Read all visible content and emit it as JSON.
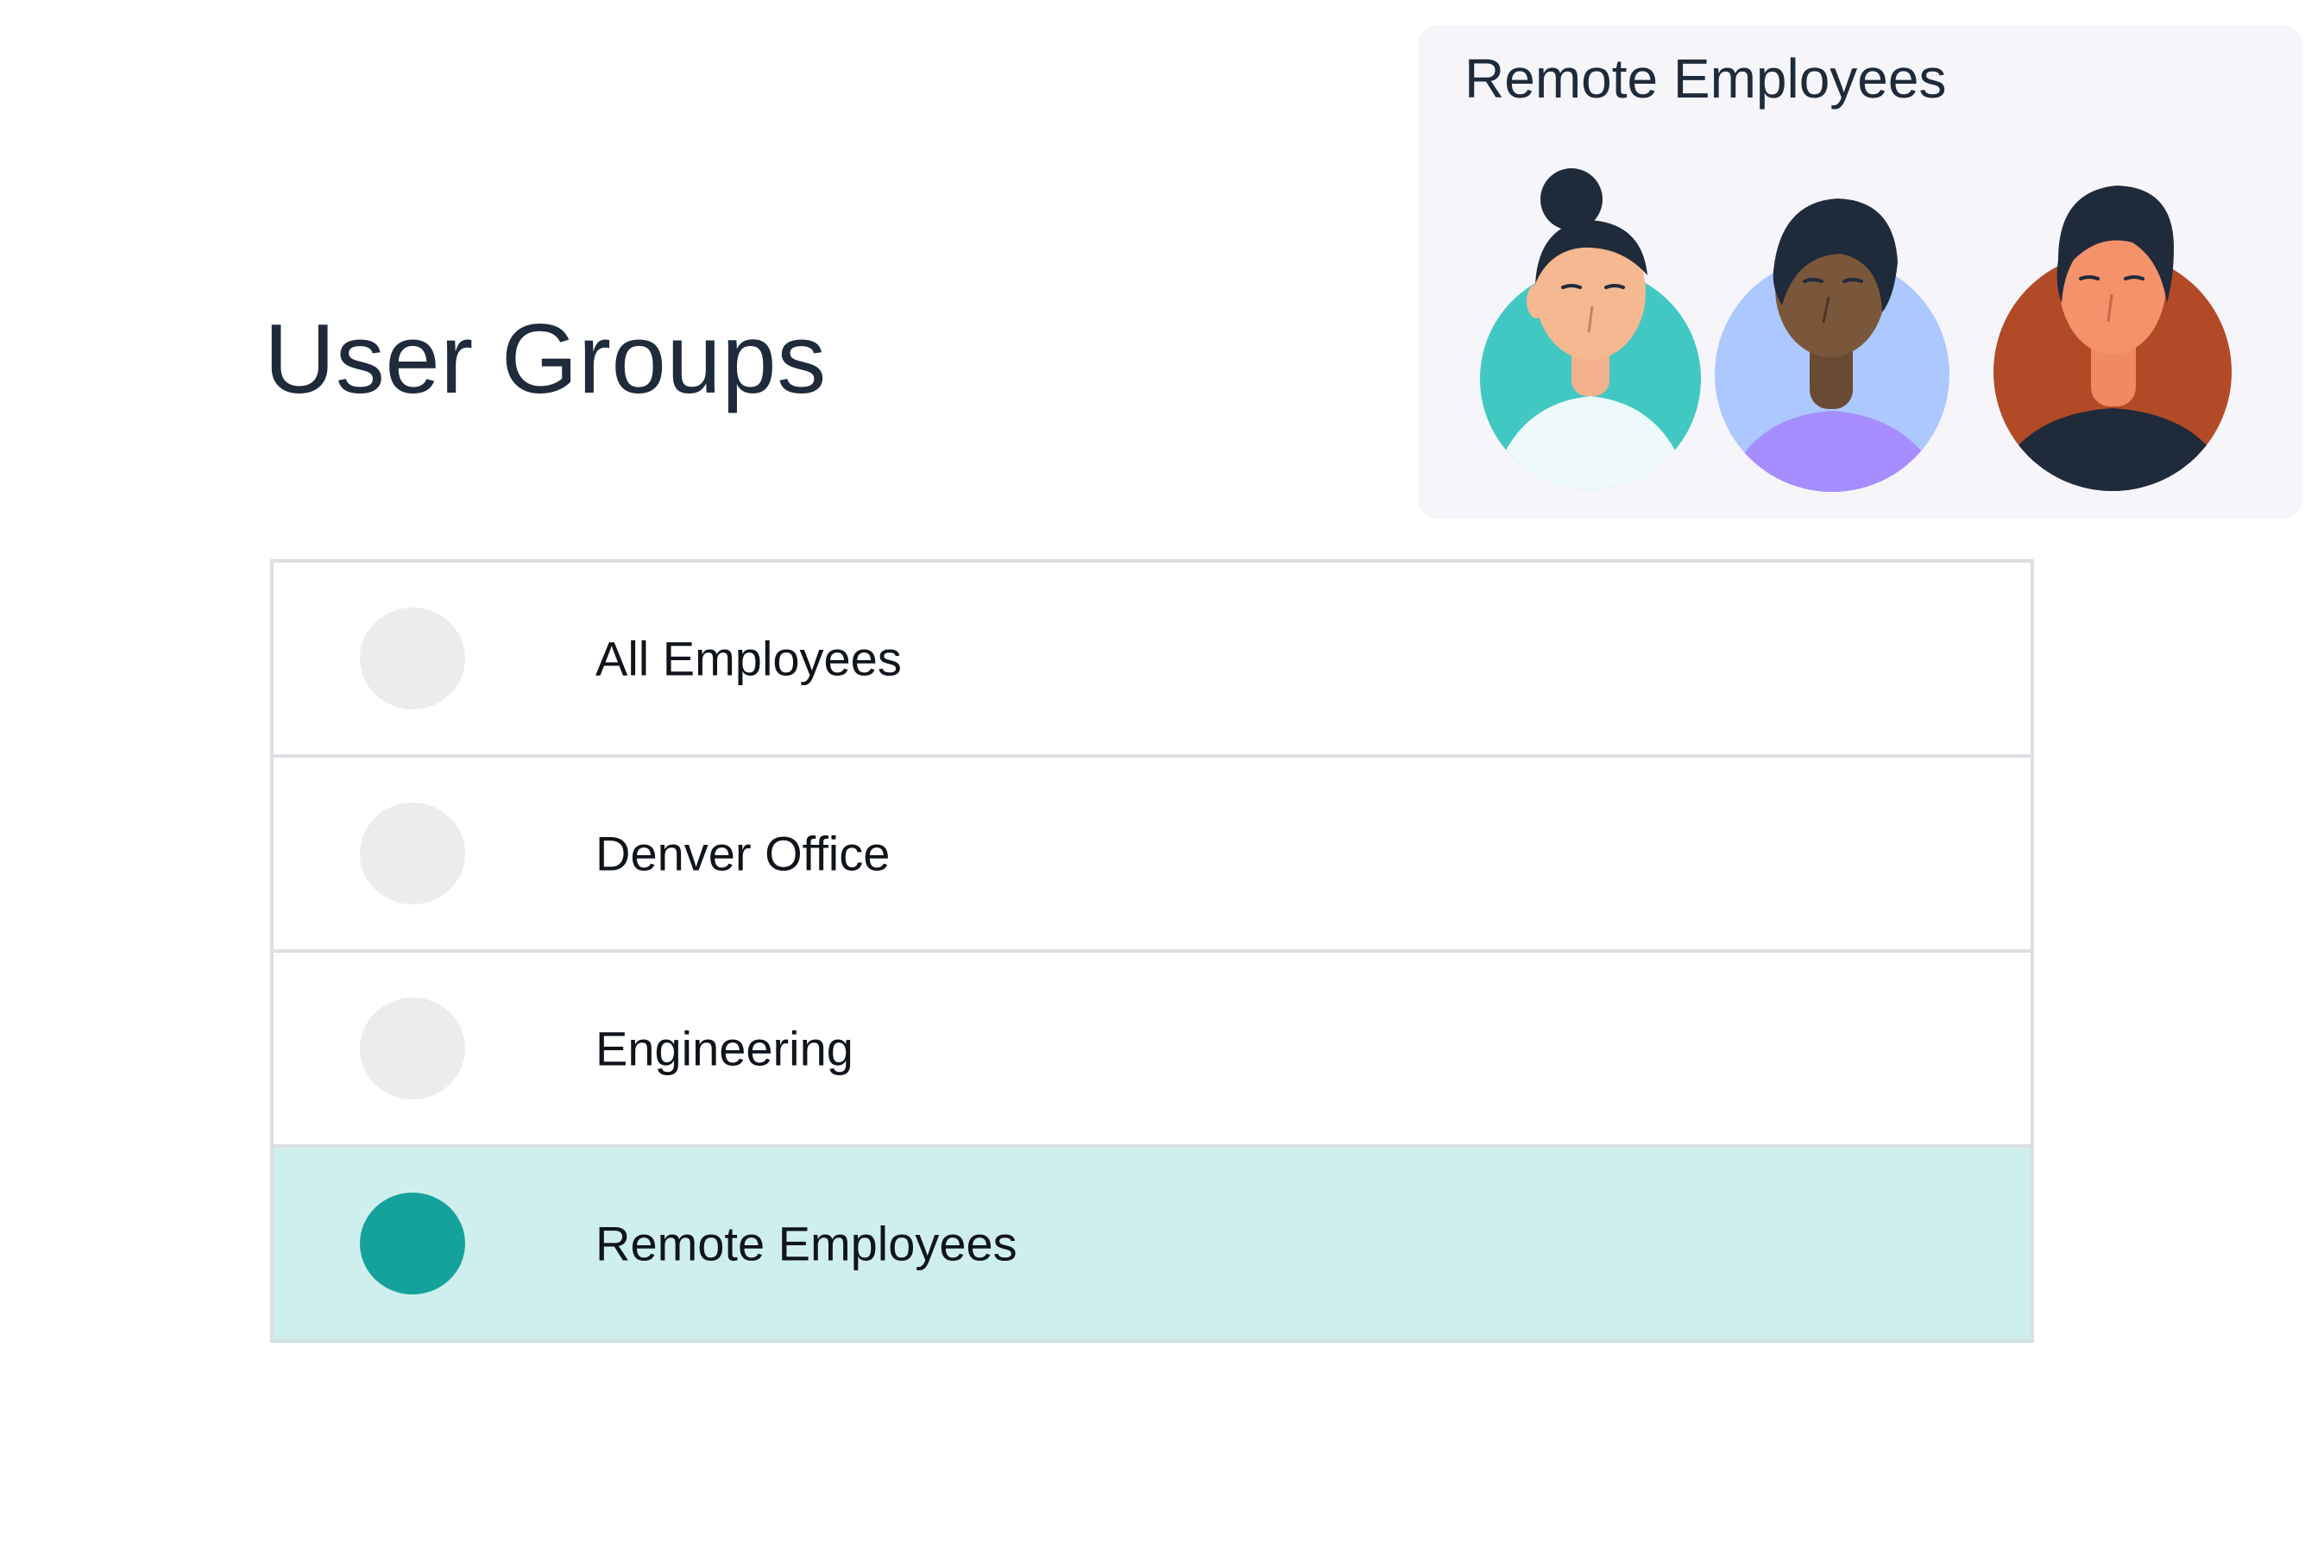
{
  "page": {
    "title": "User Groups"
  },
  "preview": {
    "title": "Remote Employees",
    "avatars": [
      {
        "icon": "avatar-woman-bun-icon",
        "bg_color": "#41c8c2"
      },
      {
        "icon": "avatar-man-curly-icon",
        "bg_color": "#adc8ff"
      },
      {
        "icon": "avatar-man-quiff-icon",
        "bg_color": "#b24a27"
      }
    ]
  },
  "groups": {
    "items": [
      {
        "label": "All Employees",
        "selected": false
      },
      {
        "label": "Denver Office",
        "selected": false
      },
      {
        "label": "Engineering",
        "selected": false
      },
      {
        "label": "Remote Employees",
        "selected": true
      }
    ]
  },
  "colors": {
    "accent": "#15a29b",
    "selected_row_bg": "#cfefee",
    "radio_unselected": "#ebecee",
    "title_text": "#1f2a3a",
    "card_bg": "#f5f5fa"
  }
}
